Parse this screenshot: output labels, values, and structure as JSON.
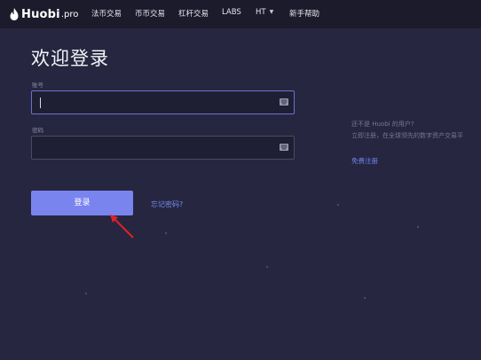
{
  "header": {
    "logo": {
      "name": "Huobi",
      "suffix": ".pro",
      "icon": "flame-icon"
    },
    "nav": [
      {
        "label": "法币交易"
      },
      {
        "label": "币币交易"
      },
      {
        "label": "杠杆交易"
      },
      {
        "label": "LABS"
      },
      {
        "label": "HT",
        "dropdown": true
      },
      {
        "label": "新手帮助"
      }
    ]
  },
  "login": {
    "title": "欢迎登录",
    "account_label": "账号",
    "account_value": "",
    "password_label": "密码",
    "password_value": "",
    "submit_label": "登录",
    "forgot_label": "忘记密码?"
  },
  "side": {
    "line1": "还不是 Huobi 的用户?",
    "line2": "立即注册，在全球领先的数字资产交易平",
    "signup_label": "免费注册"
  },
  "colors": {
    "background": "#262641",
    "header_bg": "#1b1b2b",
    "accent": "#7a84ee",
    "link": "#7b8af0",
    "annotation": "#e02424"
  }
}
